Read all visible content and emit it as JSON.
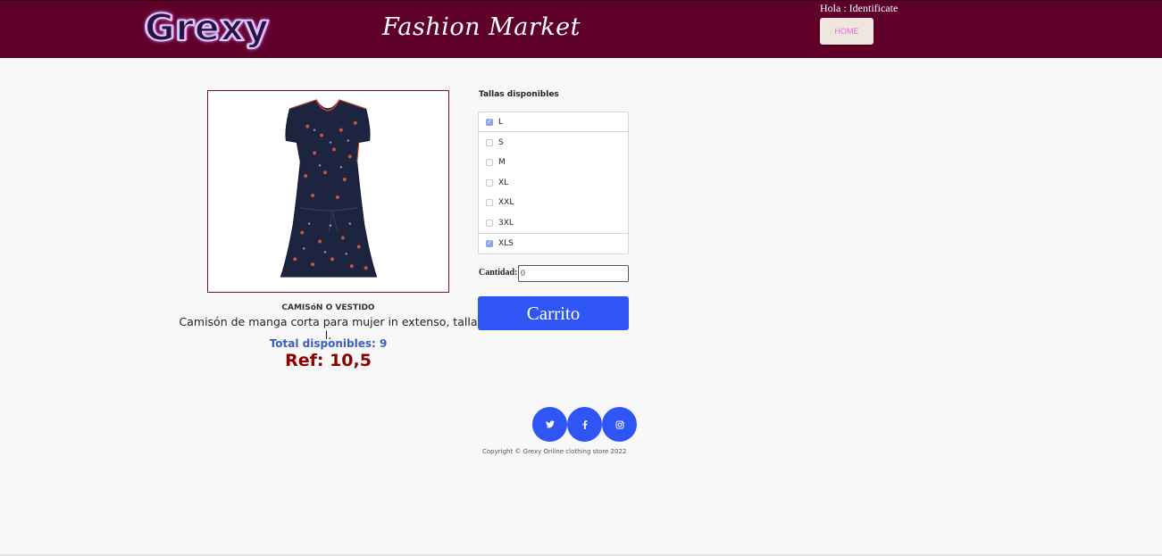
{
  "header": {
    "logo_text": "Grexy",
    "brand_title": "Fashion Market",
    "greeting": "Hola : Identificate",
    "home_label": "HOME",
    "bg_color": "#5e0029"
  },
  "product": {
    "category": "CAMISóN O VESTIDO",
    "description": "Camisón de manga corta para mujer in extenso, talla l.",
    "stock": "Total disponibles: 9",
    "ref": "Ref: 10,5",
    "image": "navy-floral-dress"
  },
  "sizes": {
    "title": "Tallas disponibles",
    "items": [
      {
        "label": "L",
        "checked": true
      },
      {
        "label": "S",
        "checked": false
      },
      {
        "label": "M",
        "checked": false
      },
      {
        "label": "XL",
        "checked": false
      },
      {
        "label": "XXL",
        "checked": false
      },
      {
        "label": "3XL",
        "checked": false
      },
      {
        "label": "XLS",
        "checked": true
      }
    ]
  },
  "quantity": {
    "label": "Cantidad:",
    "value": "0"
  },
  "cart": {
    "label": "Carrito",
    "color": "#2f55f5"
  },
  "footer": {
    "social_icons": [
      "twitter-icon",
      "facebook-icon",
      "instagram-icon"
    ],
    "copyright": "Copyright © Grexy Online clothing store 2022"
  }
}
